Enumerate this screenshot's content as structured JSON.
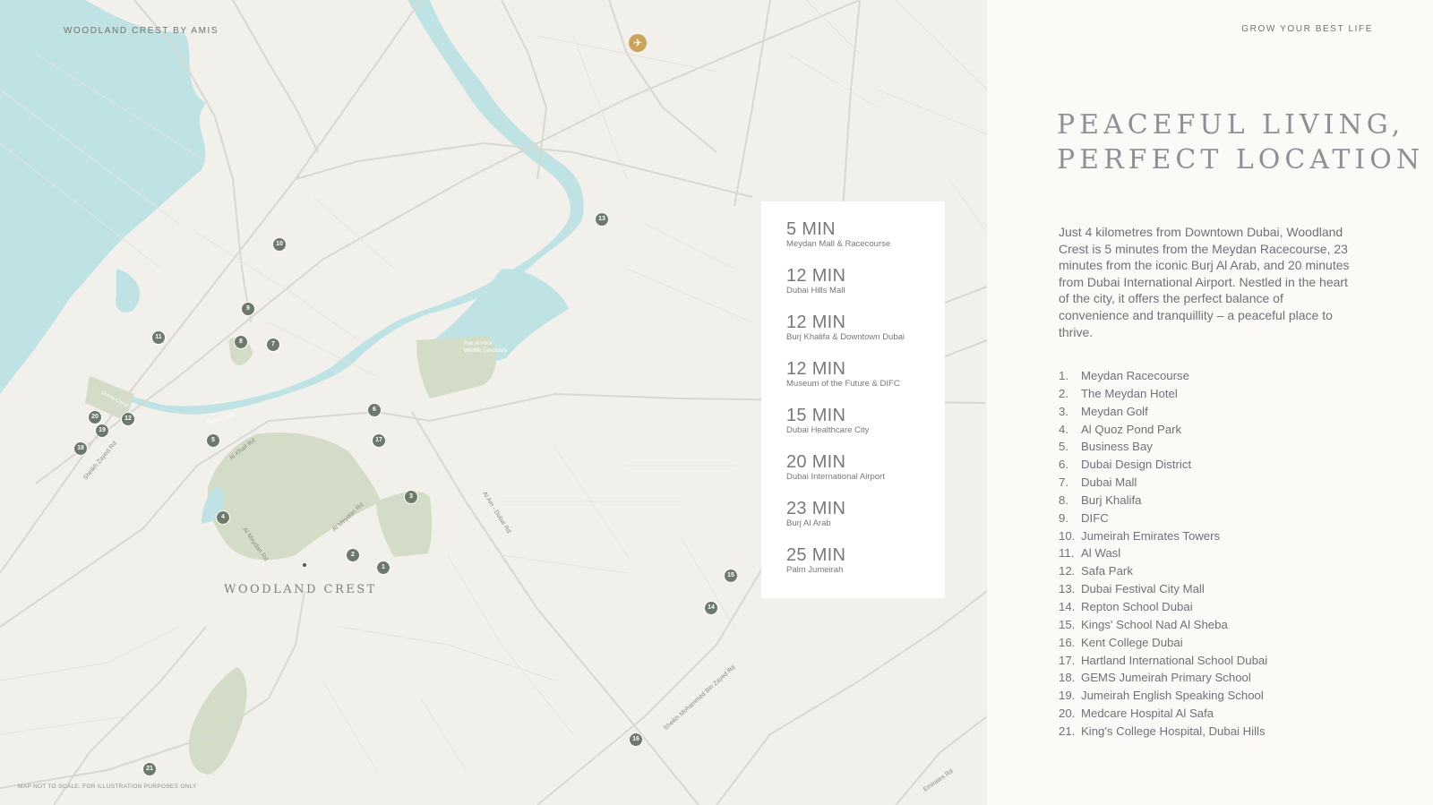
{
  "brand": "WOODLAND CREST BY AMIS",
  "tagline": "GROW YOUR BEST LIFE",
  "headline": [
    "PEACEFUL LIVING,",
    "PERFECT LOCATION"
  ],
  "intro": "Just 4 kilometres from Downtown Dubai, Woodland Crest is 5 minutes from the Meydan Racecourse, 23 minutes from the iconic Burj Al Arab, and 20 minutes from Dubai International Airport. Nestled in the heart of the city, it offers the perfect balance of convenience and tranquillity – a peaceful place to thrive.",
  "travel_times": [
    {
      "time": "5 MIN",
      "destination": "Meydan Mall & Racecourse"
    },
    {
      "time": "12 MIN",
      "destination": "Dubai Hills Mall"
    },
    {
      "time": "12 MIN",
      "destination": "Burj Khalifa & Downtown Dubai"
    },
    {
      "time": "12 MIN",
      "destination": "Museum of the Future & DIFC"
    },
    {
      "time": "15 MIN",
      "destination": "Dubai Healthcare City"
    },
    {
      "time": "20 MIN",
      "destination": "Dubai International Airport"
    },
    {
      "time": "23 MIN",
      "destination": "Burj Al Arab"
    },
    {
      "time": "25 MIN",
      "destination": "Palm Jumeirah"
    }
  ],
  "points_of_interest": [
    {
      "num": "1.",
      "name": "Meydan Racecourse"
    },
    {
      "num": "2.",
      "name": "The Meydan Hotel"
    },
    {
      "num": "3.",
      "name": "Meydan Golf"
    },
    {
      "num": "4.",
      "name": "Al Quoz Pond Park"
    },
    {
      "num": "5.",
      "name": "Business Bay"
    },
    {
      "num": "6.",
      "name": "Dubai Design District"
    },
    {
      "num": "7.",
      "name": "Dubai Mall"
    },
    {
      "num": "8.",
      "name": "Burj Khalifa"
    },
    {
      "num": "9.",
      "name": "DIFC"
    },
    {
      "num": "10.",
      "name": "Jumeirah Emirates Towers"
    },
    {
      "num": "11.",
      "name": "Al Wasl"
    },
    {
      "num": "12.",
      "name": "Safa Park"
    },
    {
      "num": "13.",
      "name": "Dubai Festival City Mall"
    },
    {
      "num": "14.",
      "name": "Repton School Dubai"
    },
    {
      "num": "15.",
      "name": "Kings' School Nad Al Sheba"
    },
    {
      "num": "16.",
      "name": "Kent College Dubai"
    },
    {
      "num": "17.",
      "name": "Hartland International School Dubai"
    },
    {
      "num": "18.",
      "name": "GEMS Jumeirah Primary School"
    },
    {
      "num": "19.",
      "name": "Jumeirah English Speaking School"
    },
    {
      "num": "20.",
      "name": "Medcare Hospital Al Safa"
    },
    {
      "num": "21.",
      "name": "King's College Hospital, Dubai Hills"
    }
  ],
  "map": {
    "marker_labels": [
      "1",
      "2",
      "3",
      "4",
      "5",
      "6",
      "7",
      "8",
      "9",
      "10",
      "11",
      "12",
      "13",
      "14",
      "15",
      "16",
      "17",
      "18",
      "19",
      "20",
      "21"
    ],
    "airport_icon": "plane-icon",
    "site_label": "WOODLAND CREST",
    "roads": [
      "Al Khail Rd",
      "Al Meydan Rd",
      "Al Meydan Rd",
      "Al Ain - Dubai Rd",
      "Sheikh Zayed Rd",
      "Sheikh Mohammed Bin Zayed Rd",
      "Emirates Rd"
    ],
    "water_labels": [
      "Dubai Canal",
      "Dubai Creek",
      "Ras Al Khor Wildlife Sanctuary"
    ],
    "disclaimer": "MAP NOT TO SCALE. FOR ILLUSTRATION PURPOSES ONLY"
  },
  "colors": {
    "water": "#bfe3e4",
    "park": "#d3dcc6",
    "road": "#d8d7d2",
    "marker": "#6d7a6b",
    "airport": "#c9a45a",
    "panel": "#ffffff"
  }
}
